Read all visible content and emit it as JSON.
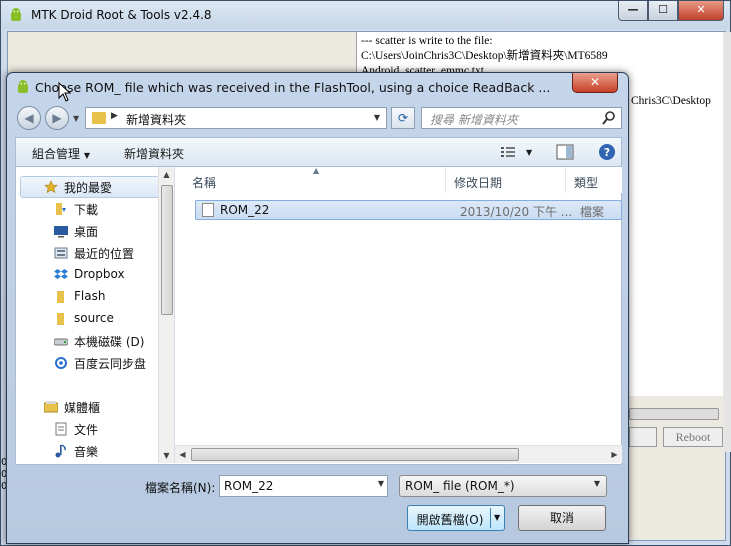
{
  "bg_window": {
    "title": "MTK Droid Root & Tools v2.4.8",
    "caption": {
      "minimize": "—",
      "maximize": "☐",
      "close": "✕"
    },
    "log_lines": [
      "--- scatter is write to the file:",
      "C:\\Users\\JoinChris3C\\Desktop\\新增資料夾\\MT6589",
      "Android_scatter_emmc.txt",
      "",
      "Chris3C\\Desktop"
    ],
    "reboot_label": "Reboot",
    "edge_glyphs": [
      "0",
      "0",
      "0"
    ]
  },
  "dialog": {
    "title": "Choose ROM_ file which was received in the FlashTool, using a choice ReadBack ...",
    "close_label": "✕",
    "address": {
      "path": "新增資料夾"
    },
    "search": {
      "placeholder": "搜尋 新增資料夾"
    },
    "toolbar": {
      "organize": "組合管理",
      "new_folder": "新增資料夾"
    },
    "nav": {
      "items": [
        {
          "label": "我的最愛",
          "icon": "star-icon"
        },
        {
          "label": "下載",
          "icon": "download-folder-icon"
        },
        {
          "label": "桌面",
          "icon": "desktop-icon"
        },
        {
          "label": "最近的位置",
          "icon": "recent-places-icon"
        },
        {
          "label": "Dropbox",
          "icon": "dropbox-icon"
        },
        {
          "label": "Flash",
          "icon": "folder-icon"
        },
        {
          "label": "source",
          "icon": "folder-icon"
        },
        {
          "label": "本機磁碟 (D)",
          "icon": "drive-icon"
        },
        {
          "label": "百度云同步盘",
          "icon": "baidu-sync-icon"
        },
        {
          "label": "媒體櫃",
          "icon": "libraries-icon"
        },
        {
          "label": "文件",
          "icon": "documents-icon"
        },
        {
          "label": "音樂",
          "icon": "music-icon"
        }
      ]
    },
    "columns": {
      "name": "名稱",
      "date": "修改日期",
      "type": "類型"
    },
    "files": [
      {
        "name": "ROM_22",
        "date": "2013/10/20 下午 ...",
        "type": "檔案"
      }
    ],
    "filename_label": "檔案名稱(N):",
    "filename_value": "ROM_22",
    "filetype_value": "ROM_ file (ROM_*)",
    "open_label": "開啟舊檔(O)",
    "cancel_label": "取消"
  }
}
